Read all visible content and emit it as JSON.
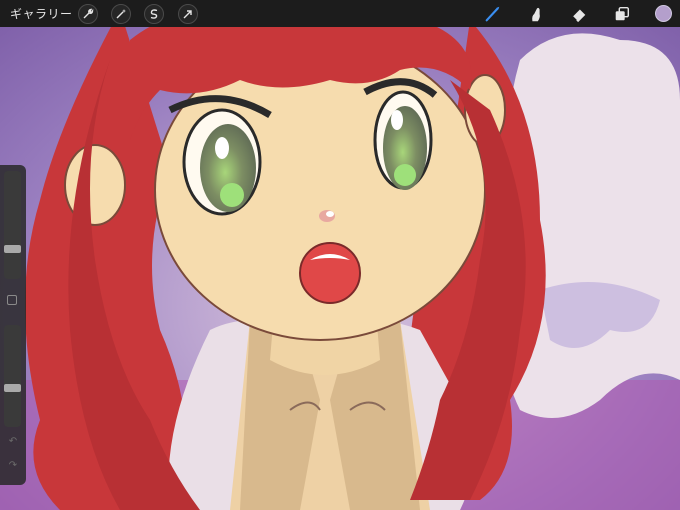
{
  "app": {
    "gallery_label": "ギャラリー"
  },
  "toolbar": {
    "left_tools": [
      {
        "name": "actions",
        "icon": "wrench-icon"
      },
      {
        "name": "adjustments",
        "icon": "magic-wand-icon"
      },
      {
        "name": "selection",
        "icon": "selection-s-icon"
      },
      {
        "name": "transform",
        "icon": "arrow-cursor-icon"
      }
    ],
    "right_tools": [
      {
        "name": "brush",
        "icon": "brush-icon",
        "active": true
      },
      {
        "name": "smudge",
        "icon": "smudge-icon"
      },
      {
        "name": "eraser",
        "icon": "eraser-icon"
      },
      {
        "name": "layers",
        "icon": "layers-icon"
      }
    ],
    "active_color": "#b49fcc",
    "accent": "#3a8ef0"
  },
  "sidebar": {
    "brush_size_level": 0.26,
    "opacity_level": 0.37
  },
  "canvas": {
    "subject": "illustration",
    "colors": {
      "hair": "#c8373a",
      "skin": "#f6dcae",
      "eyes": "#8fa46e",
      "background": "#9a7fc0",
      "cloud": "#ece1ea"
    }
  }
}
